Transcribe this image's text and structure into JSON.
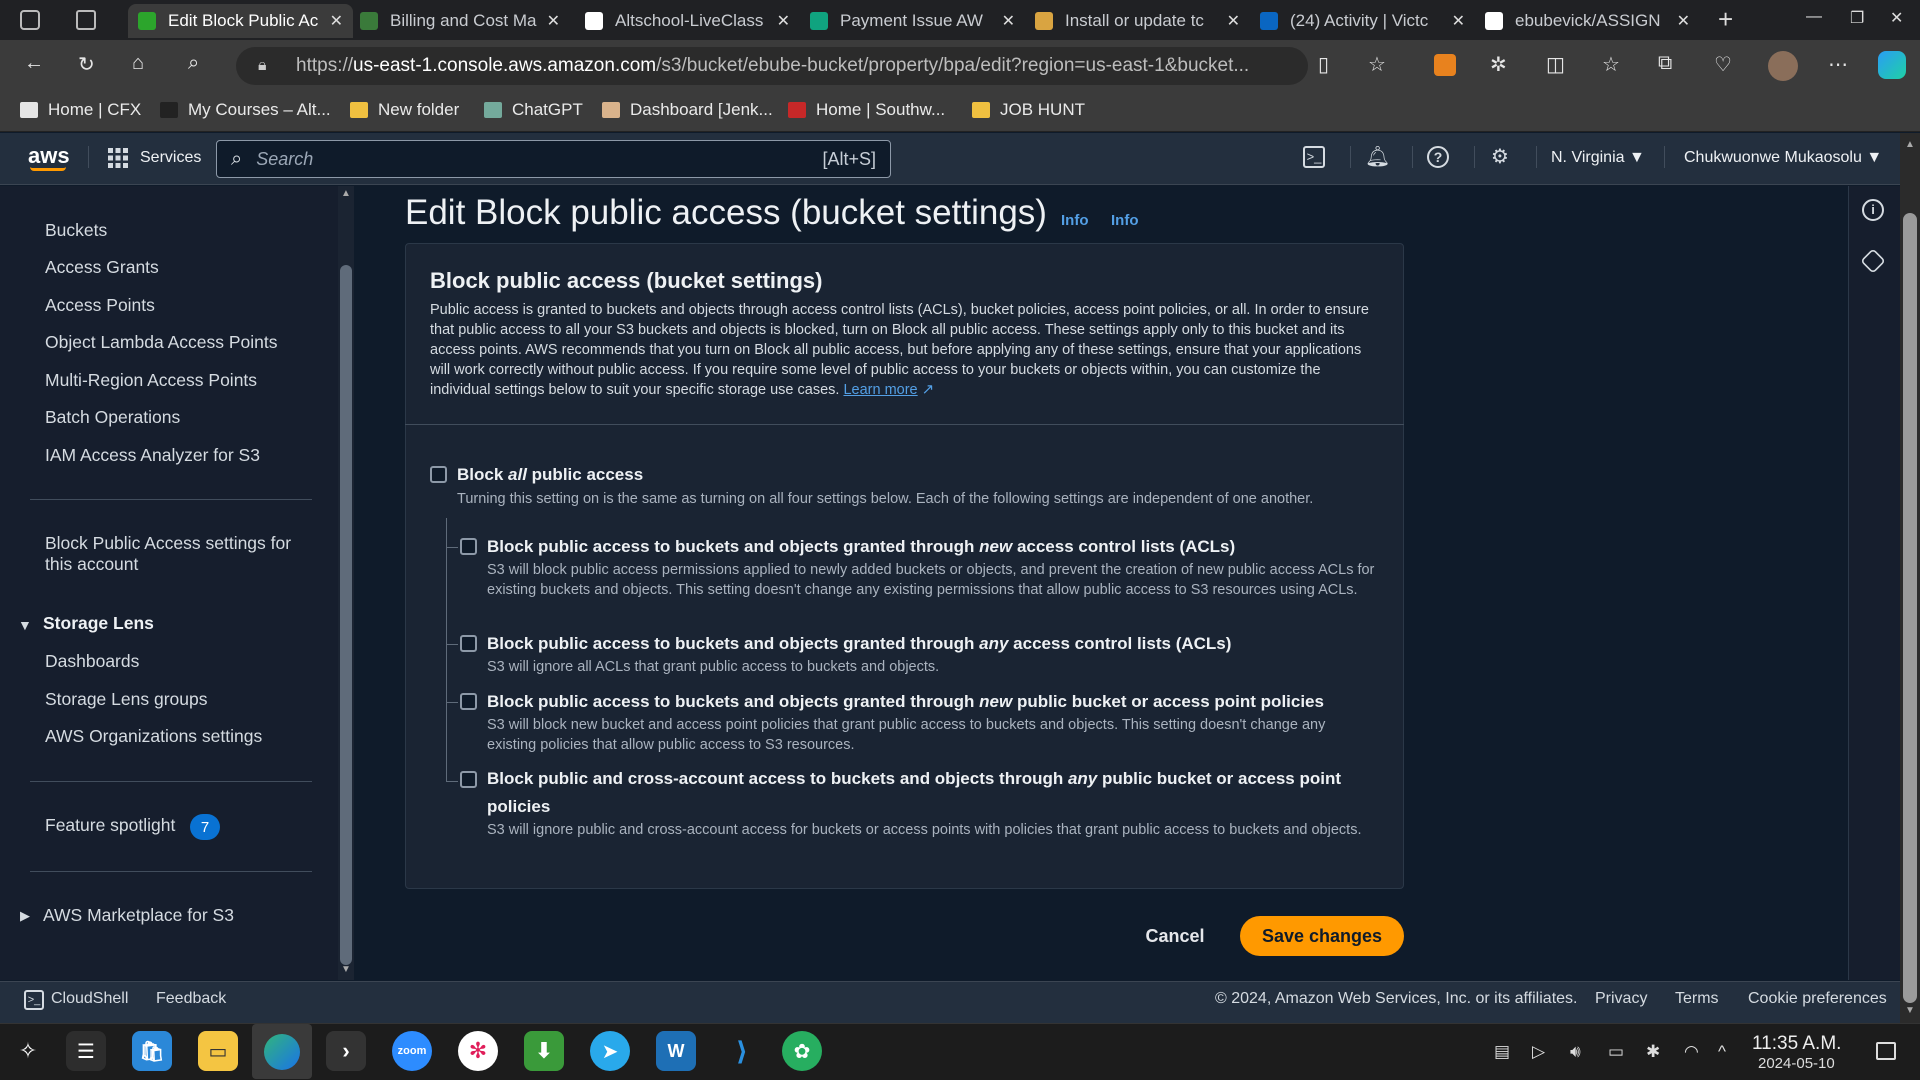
{
  "browser": {
    "tabs": [
      {
        "title": "Edit Block Public Ac",
        "color": "#2ca52c",
        "active": true
      },
      {
        "title": "Billing and Cost Ma",
        "color": "#3a7a3a"
      },
      {
        "title": "Altschool-LiveClass",
        "color": "#ffffff"
      },
      {
        "title": "Payment Issue AW",
        "color": "#10a37f"
      },
      {
        "title": "Install or update tc",
        "color": "#d9a441"
      },
      {
        "title": "(24) Activity | Victc",
        "color": "#0a66c2"
      },
      {
        "title": "ebubevick/ASSIGN",
        "color": "#ffffff"
      }
    ],
    "url_prefix": "https://",
    "url_host": "us-east-1.console.aws.amazon.com",
    "url_path": "/s3/bucket/ebube-bucket/property/bpa/edit?region=us-east-1&bucket...",
    "bookmarks": [
      {
        "label": "Home | CFX",
        "color": "#e5e5e5"
      },
      {
        "label": "My Courses – Alt...",
        "color": "#222"
      },
      {
        "label": "New folder",
        "color": "#f0c040"
      },
      {
        "label": "ChatGPT",
        "color": "#74aa9c"
      },
      {
        "label": "Dashboard [Jenk...",
        "color": "#d9b38c"
      },
      {
        "label": "Home | Southw...",
        "color": "#c62828"
      },
      {
        "label": "JOB HUNT",
        "color": "#f0c040"
      }
    ]
  },
  "aws": {
    "logo": "aws",
    "services_label": "Services",
    "search_placeholder": "Search",
    "search_shortcut": "[Alt+S]",
    "region": "N. Virginia",
    "account": "Chukwuonwe Mukaosolu"
  },
  "sidebar": {
    "items": [
      "Buckets",
      "Access Grants",
      "Access Points",
      "Object Lambda Access Points",
      "Multi-Region Access Points",
      "Batch Operations",
      "IAM Access Analyzer for S3"
    ],
    "bpa_line1": "Block Public Access settings for",
    "bpa_line2": "this account",
    "storage_lens": "Storage Lens",
    "lens_items": [
      "Dashboards",
      "Storage Lens groups",
      "AWS Organizations settings"
    ],
    "feature_spotlight": "Feature spotlight",
    "feature_count": "7",
    "marketplace": "AWS Marketplace for S3"
  },
  "main": {
    "title": "Edit Block public access (bucket settings)",
    "info1": "Info",
    "info2": "Info",
    "panel_title": "Block public access (bucket settings)",
    "panel_desc": "Public access is granted to buckets and objects through access control lists (ACLs), bucket policies, access point policies, or all. In order to ensure that public access to all your S3 buckets and objects is blocked, turn on Block all public access. These settings apply only to this bucket and its access points. AWS recommends that you turn on Block all public access, but before applying any of these settings, ensure that your applications will work correctly without public access. If you require some level of public access to your buckets or objects within, you can customize the individual settings below to suit your specific storage use cases.",
    "learn_more": "Learn more",
    "block_all_pre": "Block ",
    "block_all_em": "all",
    "block_all_post": " public access",
    "block_all_desc": "Turning this setting on is the same as turning on all four settings below. Each of the following settings are independent of one another.",
    "options": [
      {
        "pre": "Block public access to buckets and objects granted through ",
        "em": "new",
        "post": " access control lists (ACLs)",
        "desc": "S3 will block public access permissions applied to newly added buckets or objects, and prevent the creation of new public access ACLs for existing buckets and objects. This setting doesn't change any existing permissions that allow public access to S3 resources using ACLs."
      },
      {
        "pre": "Block public access to buckets and objects granted through ",
        "em": "any",
        "post": " access control lists (ACLs)",
        "desc": "S3 will ignore all ACLs that grant public access to buckets and objects."
      },
      {
        "pre": "Block public access to buckets and objects granted through ",
        "em": "new",
        "post": " public bucket or access point policies",
        "desc": "S3 will block new bucket and access point policies that grant public access to buckets and objects. This setting doesn't change any existing policies that allow public access to S3 resources."
      },
      {
        "pre": "Block public and cross-account access to buckets and objects through ",
        "em": "any",
        "post": " public bucket or access point",
        "post2": "policies",
        "desc": "S3 will ignore public and cross-account access for buckets or access points with policies that grant public access to buckets and objects."
      }
    ],
    "cancel": "Cancel",
    "save": "Save changes"
  },
  "footer": {
    "cloudshell": "CloudShell",
    "feedback": "Feedback",
    "copyright": "© 2024, Amazon Web Services, Inc. or its affiliates.",
    "privacy": "Privacy",
    "terms": "Terms",
    "cookies": "Cookie preferences"
  },
  "taskbar": {
    "zoom_label": "zoom",
    "time": "11:35 A.M.",
    "date": "2024-05-10"
  },
  "colors": {
    "accent": "#ff9900",
    "link": "#539fe5",
    "badge": "#0972d3"
  }
}
